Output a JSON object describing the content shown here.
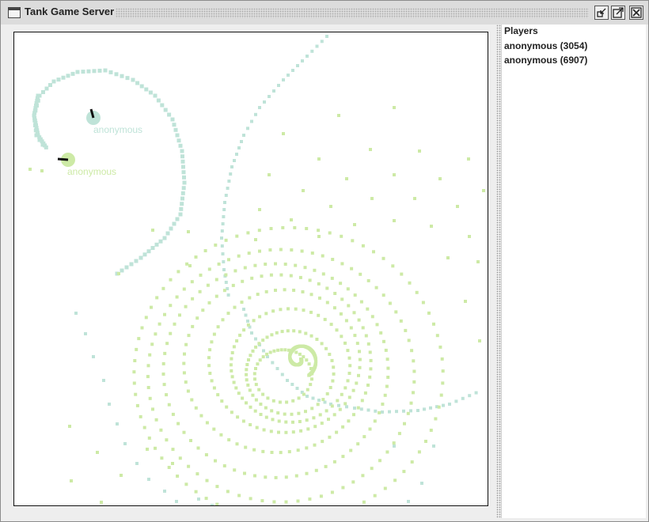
{
  "window": {
    "title": "Tank Game Server",
    "icon": "window-icon",
    "controls": [
      "minimize-icon",
      "maximize-icon",
      "close-icon"
    ]
  },
  "arena": {
    "tanks": [
      {
        "name": "anonymous",
        "color": "#bfe3d8",
        "heading_deg": 110
      },
      {
        "name": "anonymous",
        "color": "#cdeaa6",
        "heading_deg": 180
      }
    ],
    "trail_colors": {
      "blue_green": "#bfe3d8",
      "green": "#cdeaa6"
    }
  },
  "players": {
    "heading": "Players",
    "items": [
      {
        "label": "anonymous (3054)"
      },
      {
        "label": "anonymous (6907)"
      }
    ]
  }
}
